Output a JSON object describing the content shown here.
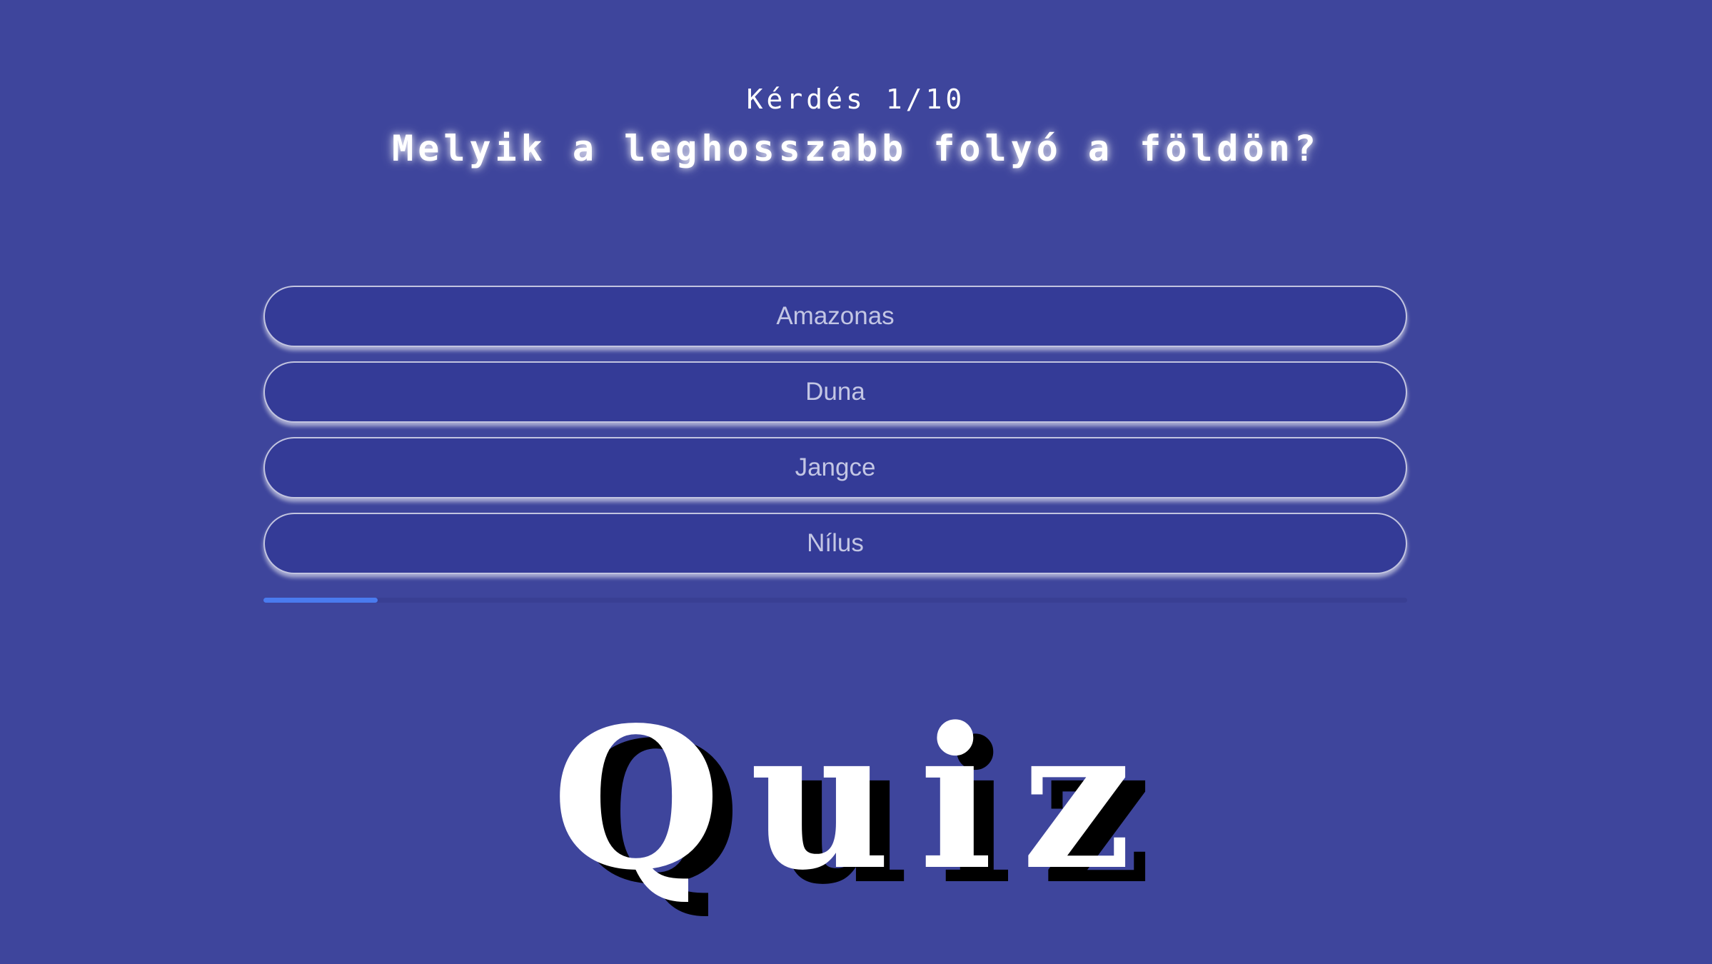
{
  "header": {
    "counter": "Kérdés 1/10",
    "question": "Melyik a leghosszabb folyó a földön?"
  },
  "answers": [
    {
      "label": "Amazonas"
    },
    {
      "label": "Duna"
    },
    {
      "label": "Jangce"
    },
    {
      "label": "Nílus"
    }
  ],
  "progress": {
    "fraction": 0.1
  },
  "logo": {
    "text": "Quiz"
  },
  "colors": {
    "background": "#3e459c",
    "answer_bg": "#343b97",
    "progress_fill": "#4a7bef",
    "logo_shadow": "#000000"
  }
}
